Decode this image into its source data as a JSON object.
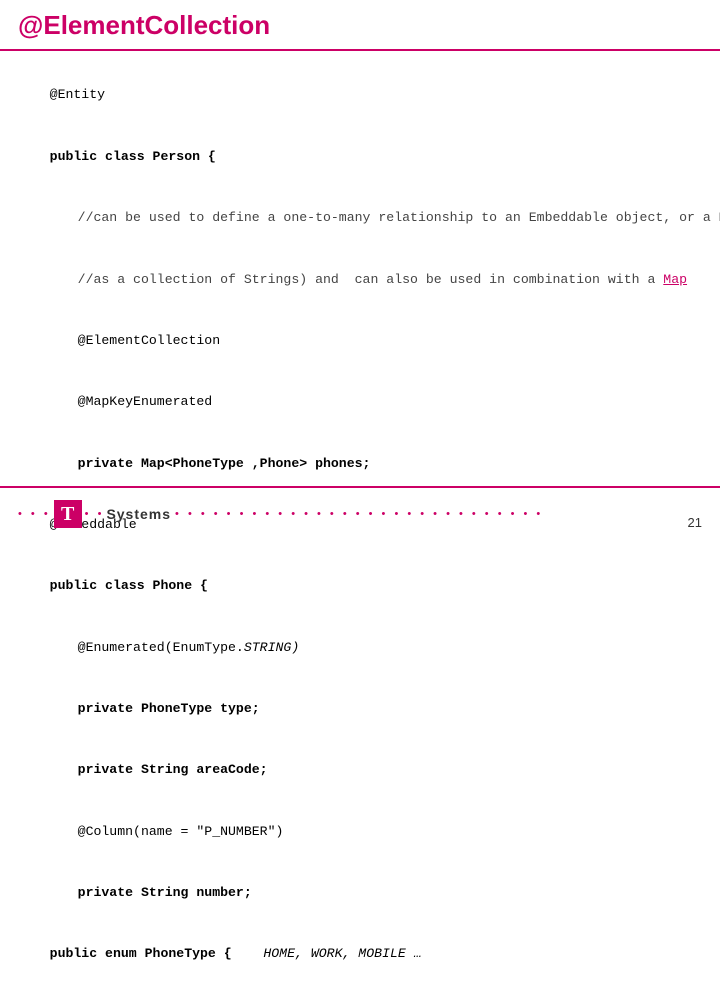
{
  "title": "@ElementCollection",
  "content": {
    "lines": [
      {
        "text": "@Entity",
        "style": "normal",
        "indent": 0
      },
      {
        "text": "public class Person {",
        "style": "bold",
        "indent": 0
      },
      {
        "text": "//can be used to define a one-to-many relationship to an Embeddable object, or a Basic value (such",
        "style": "comment",
        "indent": 1
      },
      {
        "text": "//as a collection of Strings) and  can also be used in combination with a ",
        "style": "comment",
        "indent": 1,
        "link": "Map"
      },
      {
        "text": "@ElementCollection",
        "style": "normal",
        "indent": 1
      },
      {
        "text": "@MapKeyEnumerated",
        "style": "normal",
        "indent": 1
      },
      {
        "text": "private Map<PhoneType ,Phone> phones;",
        "style": "bold",
        "indent": 1
      },
      {
        "text": "@Embeddable",
        "style": "normal",
        "indent": 0
      },
      {
        "text": "public class Phone {",
        "style": "bold",
        "indent": 0
      },
      {
        "text": "@Enumerated(EnumType.",
        "style": "normal-italic",
        "indent": 1,
        "italic_part": "STRING)"
      },
      {
        "text": "private PhoneType type;",
        "style": "bold",
        "indent": 1
      },
      {
        "text": "private String areaCode;",
        "style": "bold",
        "indent": 1
      },
      {
        "text": "@Column(name = \"P_NUMBER\")",
        "style": "normal",
        "indent": 1
      },
      {
        "text": "private String number;",
        "style": "bold",
        "indent": 1
      },
      {
        "text": "public enum PhoneType {",
        "style": "bold-inline",
        "indent": 0,
        "suffix": "    HOME, WORK, MOBILE …",
        "suffix_style": "italic"
      }
    ]
  },
  "footer": {
    "logo_dots_left": "• • •",
    "logo_t": "T",
    "logo_dots_middle": "• •",
    "logo_systems": "Systems",
    "logo_dots_right": "• • • • • • • • • • • • • • • • • • • • • • • • • • • • •",
    "page_number": "21"
  }
}
